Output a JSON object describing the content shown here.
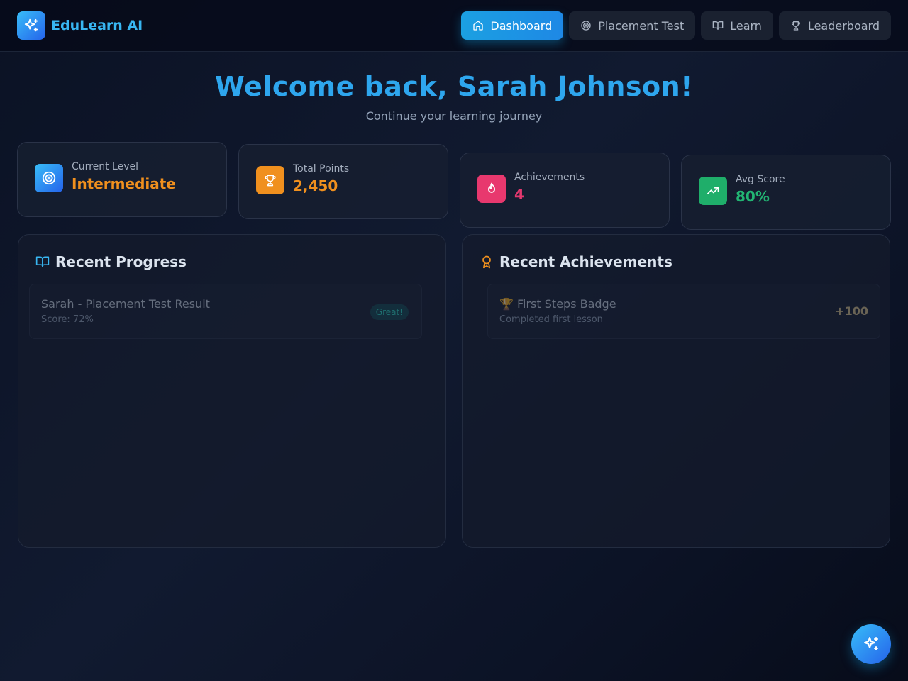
{
  "brand": {
    "name": "EduLearn AI",
    "logo_icon": "sparkles-icon"
  },
  "nav": {
    "items": [
      {
        "label": "Dashboard",
        "icon": "home-icon",
        "active": true
      },
      {
        "label": "Placement Test",
        "icon": "target-icon",
        "active": false
      },
      {
        "label": "Learn",
        "icon": "book-icon",
        "active": false
      },
      {
        "label": "Leaderboard",
        "icon": "trophy-icon",
        "active": false
      }
    ]
  },
  "hero": {
    "title": "Welcome back, Sarah Johnson!",
    "subtitle": "Continue your learning journey"
  },
  "stats": [
    {
      "label": "Current Level",
      "value": "Intermediate",
      "icon": "target-icon",
      "color": "#f0901e"
    },
    {
      "label": "Total Points",
      "value": "2,450",
      "icon": "trophy-icon",
      "color": "#f0901e"
    },
    {
      "label": "Achievements",
      "value": "4",
      "icon": "flame-icon",
      "color": "#e3386e"
    },
    {
      "label": "Avg Score",
      "value": "80%",
      "icon": "trending-up-icon",
      "color": "#22b573"
    }
  ],
  "recent_progress": {
    "title": "Recent Progress",
    "icon": "book-open-icon",
    "items": [
      {
        "title": "Sarah - Placement Test Result",
        "subtitle": "Score: 72%",
        "badge": "Great!"
      }
    ]
  },
  "recent_achievements": {
    "title": "Recent Achievements",
    "icon": "award-icon",
    "items": [
      {
        "title": "🏆 First Steps Badge",
        "subtitle": "Completed first lesson",
        "points": "+100"
      }
    ]
  },
  "fab": {
    "icon": "sparkles-icon"
  },
  "colors": {
    "accent": "#1ba0e2",
    "title": "#2ea6ee",
    "level_gradient": [
      "#38bdf8",
      "#2563eb"
    ],
    "points_bg": "#f0901e",
    "achievements_bg": "#e8386e",
    "score_bg": "#1fae6a"
  }
}
